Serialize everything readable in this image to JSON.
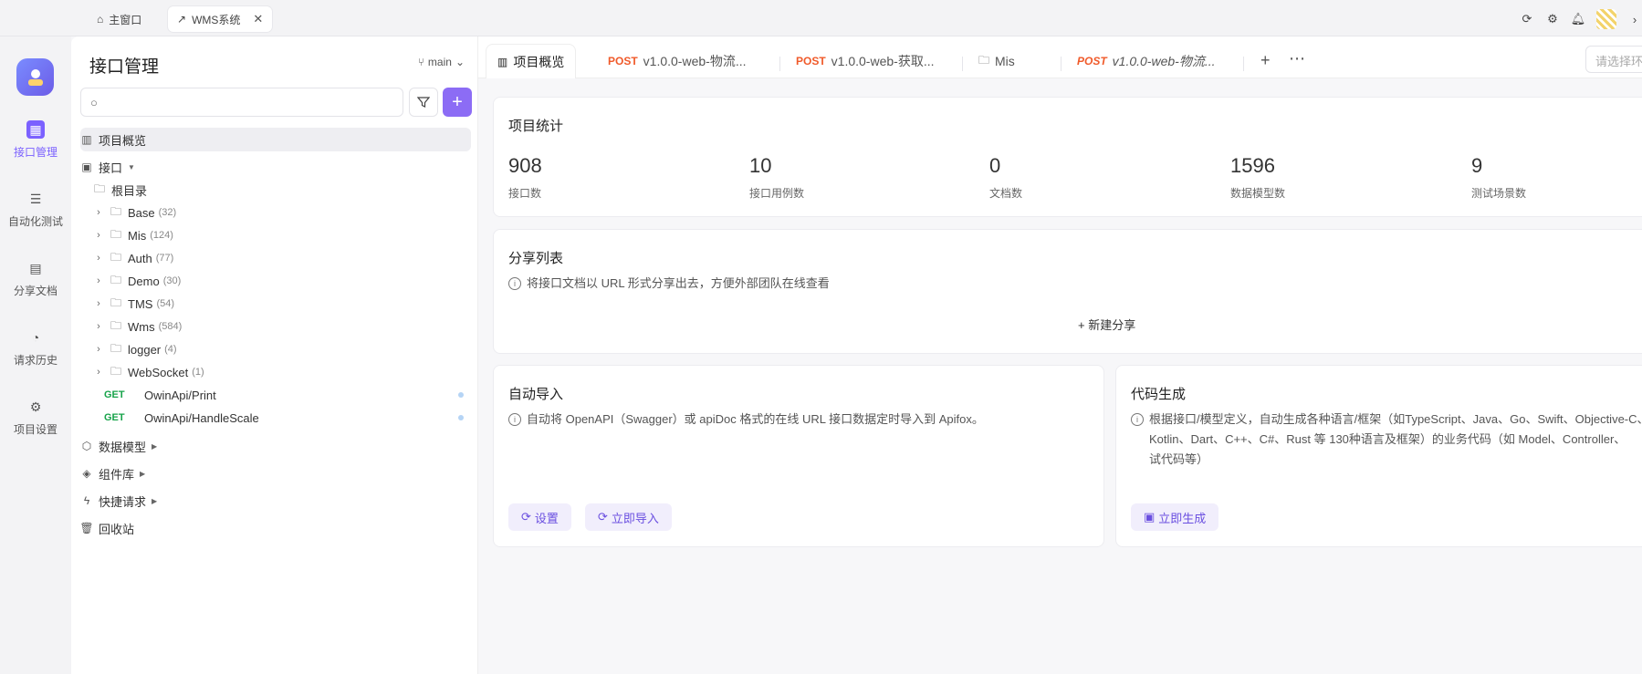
{
  "window_tabs": [
    {
      "label": "主窗口",
      "icon": "home-icon"
    },
    {
      "label": "WMS系统",
      "icon": "link-icon",
      "close": "✕"
    }
  ],
  "rail": [
    {
      "label": "接口管理",
      "icon": "api-icon"
    },
    {
      "label": "自动化测试",
      "icon": "layers-icon"
    },
    {
      "label": "分享文档",
      "icon": "share-doc-icon"
    },
    {
      "label": "请求历史",
      "icon": "history-icon"
    },
    {
      "label": "项目设置",
      "icon": "settings-icon"
    }
  ],
  "sidebar": {
    "title": "接口管理",
    "branch": "main",
    "search_placeholder": "",
    "overview": "项目概览",
    "interfaces_label": "接口",
    "root": "根目录",
    "folders": [
      {
        "name": "Base",
        "count": "(32)"
      },
      {
        "name": "Mis",
        "count": "(124)"
      },
      {
        "name": "Auth",
        "count": "(77)"
      },
      {
        "name": "Demo",
        "count": "(30)"
      },
      {
        "name": "TMS",
        "count": "(54)"
      },
      {
        "name": "Wms",
        "count": "(584)"
      },
      {
        "name": "logger",
        "count": "(4)"
      },
      {
        "name": "WebSocket",
        "count": "(1)"
      }
    ],
    "endpoints": [
      {
        "method": "GET",
        "path": "OwinApi/Print"
      },
      {
        "method": "GET",
        "path": "OwinApi/HandleScale"
      }
    ],
    "data_model": "数据模型",
    "components": "组件库",
    "quick_request": "快捷请求",
    "trash": "回收站"
  },
  "main_tabs": [
    {
      "label": "项目概览"
    },
    {
      "method": "POST",
      "label": "v1.0.0-web-物流..."
    },
    {
      "method": "POST",
      "label": "v1.0.0-web-获取..."
    },
    {
      "label": "Mis"
    },
    {
      "method": "POST",
      "label": "v1.0.0-web-物流..."
    }
  ],
  "env_placeholder": "请选择环",
  "stats": {
    "title": "项目统计",
    "items": [
      {
        "value": "908",
        "label": "接口数"
      },
      {
        "value": "10",
        "label": "接口用例数"
      },
      {
        "value": "0",
        "label": "文档数"
      },
      {
        "value": "1596",
        "label": "数据模型数"
      },
      {
        "value": "9",
        "label": "测试场景数"
      }
    ]
  },
  "share": {
    "title": "分享列表",
    "desc": "将接口文档以 URL 形式分享出去，方便外部团队在线查看",
    "new": "+ 新建分享"
  },
  "auto_import": {
    "title": "自动导入",
    "desc": "自动将 OpenAPI（Swagger）或 apiDoc 格式的在线 URL 接口数据定时导入到 Apifox。",
    "settings": "设置",
    "import_now": "立即导入"
  },
  "codegen": {
    "title": "代码生成",
    "desc1": "根据接口/模型定义，自动生成各种语言/框架（如TypeScript、Java、Go、Swift、Objective-C、",
    "desc2": "Kotlin、Dart、C++、C#、Rust 等 130种语言及框架）的业务代码（如 Model、Controller、",
    "desc3": "试代码等）",
    "generate": "立即生成"
  },
  "colors": {
    "accent": "#7b61ff",
    "get": "#17a34a",
    "post": "#f05a2a"
  }
}
